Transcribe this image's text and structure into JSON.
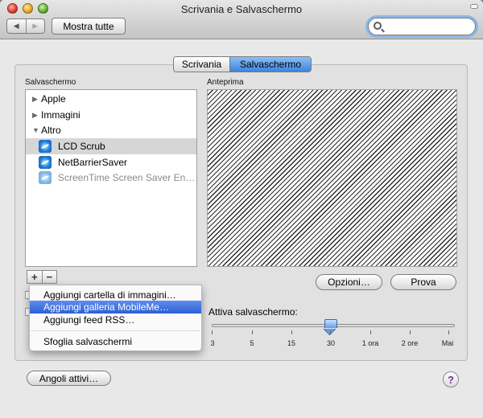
{
  "window": {
    "title": "Scrivania e Salvaschermo"
  },
  "toolbar": {
    "back_icon": "◀",
    "forward_icon": "▶",
    "show_all_label": "Mostra tutte",
    "search": {
      "value": "",
      "placeholder": ""
    }
  },
  "tabs": [
    {
      "label": "Scrivania",
      "selected": false
    },
    {
      "label": "Salvaschermo",
      "selected": true
    }
  ],
  "sidebar": {
    "title": "Salvaschermo",
    "items": [
      {
        "label": "Apple",
        "kind": "group",
        "expanded": false
      },
      {
        "label": "Immagini",
        "kind": "group",
        "expanded": false
      },
      {
        "label": "Altro",
        "kind": "group",
        "expanded": true
      },
      {
        "label": "LCD Scrub",
        "kind": "saver",
        "selected": true,
        "icon": "screensaver-icon"
      },
      {
        "label": "NetBarrierSaver",
        "kind": "saver",
        "selected": false,
        "icon": "screensaver-icon"
      },
      {
        "label": "ScreenTime Screen Saver En…",
        "kind": "saver",
        "selected": false,
        "dimmed": true,
        "icon": "screensaver-icon"
      }
    ],
    "add_label": "+",
    "remove_label": "−"
  },
  "preview": {
    "title": "Anteprima"
  },
  "buttons": {
    "options": "Opzioni…",
    "test": "Prova"
  },
  "slider": {
    "label": "Attiva salvaschermo:",
    "ticks": [
      "3",
      "5",
      "15",
      "30",
      "1 ora",
      "2 ore",
      "Mai"
    ],
    "selected": "30"
  },
  "menu": {
    "items": [
      {
        "label": "Aggiungi cartella di immagini…",
        "highlighted": false
      },
      {
        "label": "Aggiungi galleria MobileMe…",
        "highlighted": true
      },
      {
        "label": "Aggiungi feed RSS…",
        "highlighted": false
      },
      {
        "label": "Sfoglia salvaschermi",
        "highlighted": false
      }
    ]
  },
  "footer": {
    "hot_corners_label": "Angoli attivi…",
    "help_label": "?"
  },
  "colors": {
    "selection": "#3d83dc",
    "menu_highlight": "#2c5fd6",
    "help": "#7b2f9a"
  }
}
